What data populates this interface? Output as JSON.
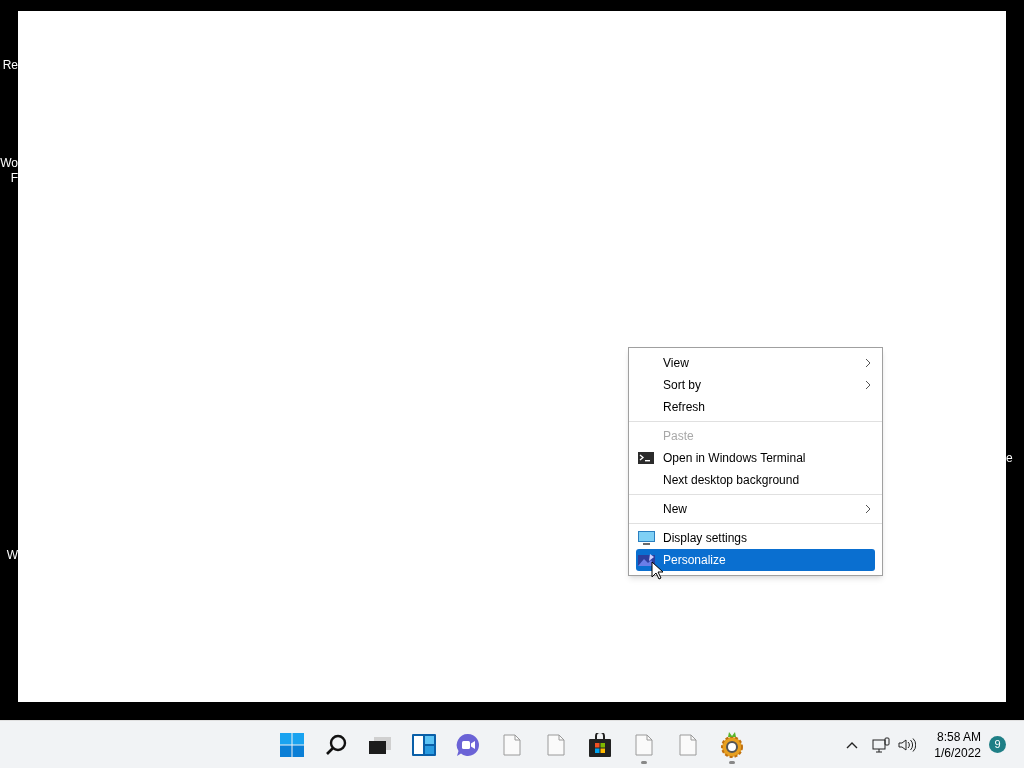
{
  "desktop_left_labels": [
    "Re",
    "Wo",
    "F",
    "W"
  ],
  "desktop_right_labels": [
    "e"
  ],
  "context_menu": {
    "items": [
      {
        "kind": "item",
        "label": "View",
        "submenu": true,
        "disabled": false,
        "selected": false
      },
      {
        "kind": "item",
        "label": "Sort by",
        "submenu": true,
        "disabled": false,
        "selected": false
      },
      {
        "kind": "item",
        "label": "Refresh",
        "submenu": false,
        "disabled": false,
        "selected": false
      },
      {
        "kind": "separator"
      },
      {
        "kind": "item",
        "label": "Paste",
        "submenu": false,
        "disabled": true,
        "selected": false
      },
      {
        "kind": "terminal",
        "label": "Open in Windows Terminal",
        "submenu": false,
        "disabled": false,
        "selected": false
      },
      {
        "kind": "item",
        "label": "Next desktop background",
        "submenu": false,
        "disabled": false,
        "selected": false
      },
      {
        "kind": "separator"
      },
      {
        "kind": "item",
        "label": "New",
        "submenu": true,
        "disabled": false,
        "selected": false
      },
      {
        "kind": "separator"
      },
      {
        "kind": "monitor",
        "label": "Display settings",
        "submenu": false,
        "disabled": false,
        "selected": false
      },
      {
        "kind": "personalize",
        "label": "Personalize",
        "submenu": false,
        "disabled": false,
        "selected": true
      }
    ]
  },
  "taskbar": {
    "apps": [
      {
        "kind": "start",
        "running": false
      },
      {
        "kind": "search",
        "running": false
      },
      {
        "kind": "taskview",
        "running": false
      },
      {
        "kind": "widgets",
        "running": false
      },
      {
        "kind": "chat",
        "running": false
      },
      {
        "kind": "file",
        "running": false
      },
      {
        "kind": "file",
        "running": false
      },
      {
        "kind": "store",
        "running": false
      },
      {
        "kind": "file",
        "running": true
      },
      {
        "kind": "file",
        "running": false
      },
      {
        "kind": "gear",
        "running": true
      }
    ],
    "tray": {
      "time": "8:58 AM",
      "date": "1/6/2022",
      "notifications": "9"
    }
  }
}
